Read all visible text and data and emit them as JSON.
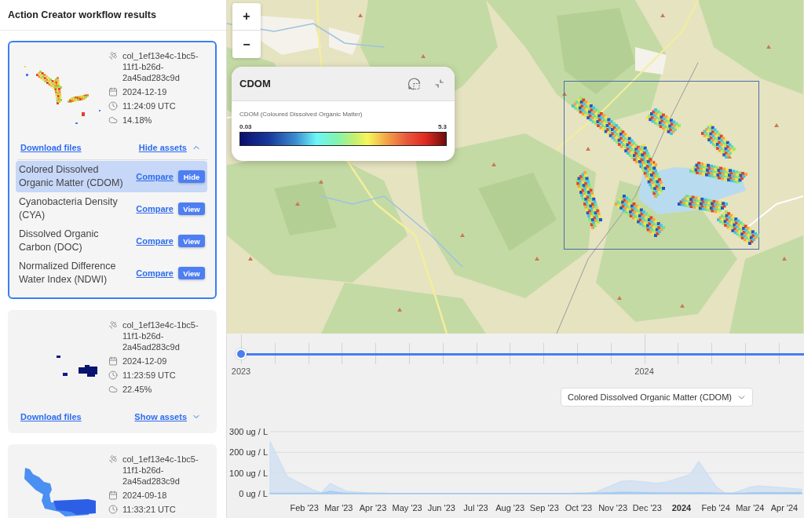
{
  "sidebar": {
    "title": "Action Creator workflow results",
    "results": [
      {
        "selected": true,
        "collection": "col_1ef13e4c-1bc5-11f1-b26d-2a45ad283c9d",
        "date": "2024-12-19",
        "time": "11:24:09 UTC",
        "cloud_cover": "14.18%",
        "download": "Download files",
        "assets_toggle": "Hide assets",
        "expanded": true,
        "assets": [
          {
            "name": "Colored Dissolved Organic Matter (CDOM)",
            "compare": "Compare",
            "action": "Hide",
            "selected": true
          },
          {
            "name": "Cyanobacteria Density (CYA)",
            "compare": "Compare",
            "action": "View",
            "selected": false
          },
          {
            "name": "Dissolved Organic Carbon (DOC)",
            "compare": "Compare",
            "action": "View",
            "selected": false
          },
          {
            "name": "Normalized Difference Water Index (NDWI)",
            "compare": "Compare",
            "action": "View",
            "selected": false
          }
        ]
      },
      {
        "selected": false,
        "collection": "col_1ef13e4c-1bc5-11f1-b26d-2a45ad283c9d",
        "date": "2024-12-09",
        "time": "11:23:59 UTC",
        "cloud_cover": "22.45%",
        "download": "Download files",
        "assets_toggle": "Show assets",
        "expanded": false
      },
      {
        "selected": false,
        "collection": "col_1ef13e4c-1bc5-11f1-b26d-2a45ad283c9d",
        "date": "2024-09-18",
        "time": "11:33:21 UTC"
      }
    ]
  },
  "map": {
    "zoom_in": "+",
    "zoom_out": "−",
    "legend": {
      "title": "CDOM",
      "description": "CDOM (Coloured Dissolved Organic Matter)",
      "min": "0.03",
      "max": "5.3"
    }
  },
  "timeline": {
    "level": 0,
    "years": [
      "2023",
      "2024"
    ]
  },
  "metric_select": {
    "value": "Colored Dissolved Organic Matter (CDOM)"
  },
  "chart": {
    "chart_data": {
      "type": "area",
      "categories": [
        null,
        null,
        null,
        null,
        "Feb '23",
        null,
        null,
        null,
        "Mar '23",
        null,
        null,
        null,
        "Apr '23",
        null,
        null,
        null,
        "May '23",
        null,
        null,
        null,
        "Jun '23",
        null,
        null,
        null,
        "Jul '23",
        null,
        null,
        null,
        "Aug '23",
        null,
        null,
        null,
        "Sep '23",
        null,
        null,
        null,
        "Oct '23",
        null,
        null,
        null,
        "Nov '23",
        null,
        null,
        null,
        "Dec '23",
        null,
        null,
        null,
        "2024",
        null,
        null,
        null,
        "Feb '24",
        null,
        null,
        null,
        "Mar '24",
        null,
        null,
        null,
        "Apr '24",
        null,
        null
      ],
      "series": [
        {
          "color": "#cfdff2",
          "values": [
            252,
            166,
            82,
            61,
            39,
            18,
            4,
            50,
            29,
            11,
            8,
            5,
            2,
            2,
            1,
            1,
            1,
            1,
            1,
            0,
            0,
            0,
            1,
            1,
            1,
            1,
            0,
            0,
            0,
            0,
            1,
            1,
            1,
            1,
            1,
            1,
            2,
            2,
            8,
            25,
            42,
            59,
            63,
            59,
            55,
            50,
            54,
            66,
            79,
            91,
            155,
            95,
            35,
            4,
            2,
            16,
            31,
            37,
            34,
            31,
            28,
            25,
            21
          ]
        },
        {
          "color": "#a6cbef",
          "values": [
            2,
            2,
            2,
            2,
            2,
            2,
            2,
            11,
            6,
            2,
            2,
            2,
            2,
            2,
            1,
            1,
            1,
            1,
            1,
            1,
            1,
            1,
            1,
            1,
            1,
            1,
            1,
            1,
            1,
            1,
            1,
            1,
            1,
            1,
            1,
            1,
            2,
            2,
            3,
            4,
            5,
            7,
            7,
            6,
            5,
            4,
            4,
            4,
            4,
            4,
            5,
            4,
            3,
            2,
            2,
            2,
            4,
            5,
            5,
            5,
            5,
            5,
            5
          ]
        }
      ],
      "ylim": [
        0,
        300
      ],
      "yticks": [
        {
          "value": 0,
          "label": "0 ug / L"
        },
        {
          "value": 100,
          "label": "100 ug / L"
        },
        {
          "value": 200,
          "label": "200 ug / L"
        },
        {
          "value": 300,
          "label": "300 ug / L"
        }
      ]
    }
  }
}
